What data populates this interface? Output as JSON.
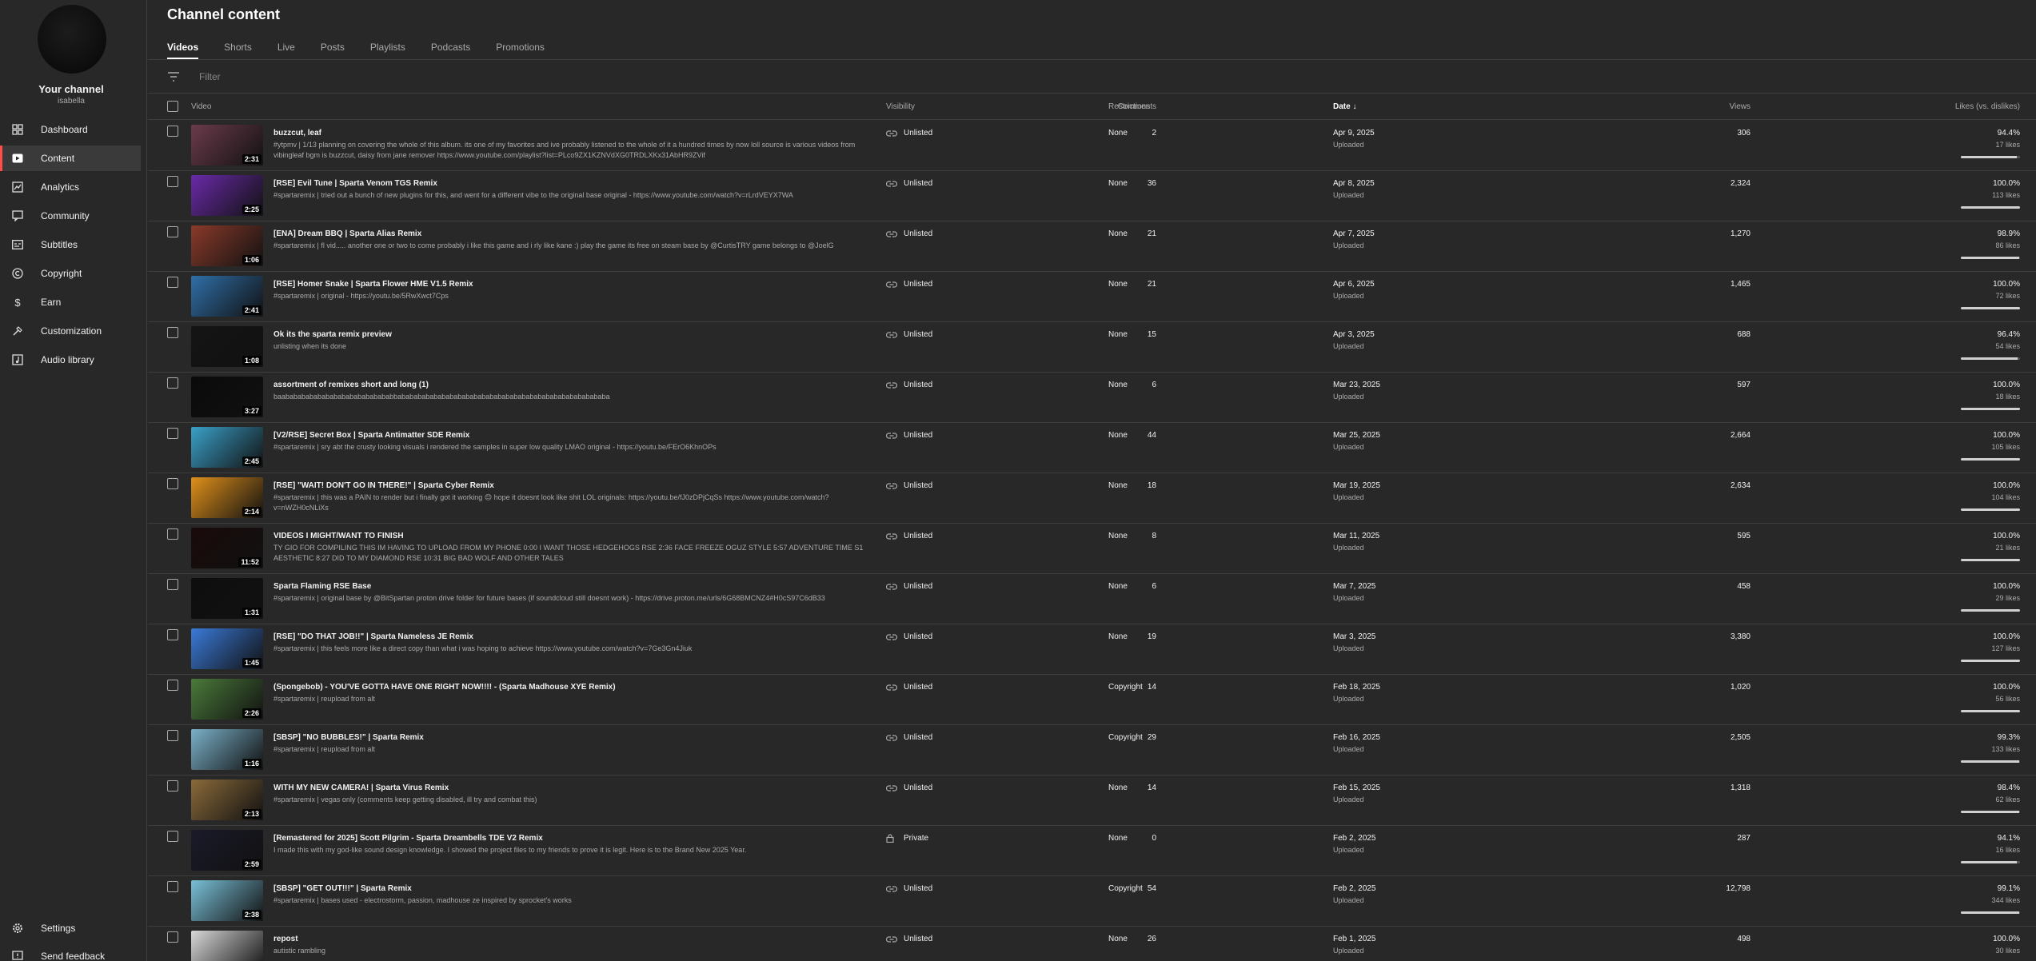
{
  "sidebar": {
    "channel_name": "Your channel",
    "channel_handle": "isabella",
    "items": [
      {
        "label": "Dashboard",
        "icon": "dashboard-icon"
      },
      {
        "label": "Content",
        "icon": "content-icon"
      },
      {
        "label": "Analytics",
        "icon": "analytics-icon"
      },
      {
        "label": "Community",
        "icon": "community-icon"
      },
      {
        "label": "Subtitles",
        "icon": "subtitles-icon"
      },
      {
        "label": "Copyright",
        "icon": "copyright-icon"
      },
      {
        "label": "Earn",
        "icon": "earn-icon"
      },
      {
        "label": "Customization",
        "icon": "customization-icon"
      },
      {
        "label": "Audio library",
        "icon": "audio-library-icon"
      }
    ],
    "bottom_items": [
      {
        "label": "Settings",
        "icon": "settings-icon"
      },
      {
        "label": "Send feedback",
        "icon": "feedback-icon"
      }
    ]
  },
  "page": {
    "title": "Channel content",
    "tabs": [
      "Videos",
      "Shorts",
      "Live",
      "Posts",
      "Playlists",
      "Podcasts",
      "Promotions"
    ],
    "active_tab": "Videos",
    "filter_placeholder": "Filter"
  },
  "table": {
    "headers": {
      "video": "Video",
      "visibility": "Visibility",
      "restrictions": "Restrictions",
      "date": "Date",
      "views": "Views",
      "comments": "Comments",
      "likes": "Likes (vs. dislikes)"
    },
    "rows": [
      {
        "title": "buzzcut, leaf",
        "desc": "#ytpmv | 1/13 planning on covering the whole of this album. its one of my favorites and ive probably listened to the whole of it a hundred times by now loll source is various videos from vibingleaf bgm is buzzcut, daisy from jane remover https://www.youtube.com/playlist?list=PLco9ZX1KZNVdXG0TRDLXKx31AbHR9ZVif",
        "duration": "2:31",
        "visibility": "Unlisted",
        "restrictions": "None",
        "date": "Apr 9, 2025",
        "date_status": "Uploaded",
        "views": "306",
        "comments": "2",
        "likes_pct": "94.4%",
        "likes_count": "17 likes",
        "likes_ratio": 0.944,
        "thumb": "#6b3b4a"
      },
      {
        "title": "[RSE] Evil Tune | Sparta Venom TGS Remix",
        "desc": "#spartaremix | tried out a bunch of new plugins for this, and went for a different vibe to the original base original - https://www.youtube.com/watch?v=rLrdVEYX7WA",
        "duration": "2:25",
        "visibility": "Unlisted",
        "restrictions": "None",
        "date": "Apr 8, 2025",
        "date_status": "Uploaded",
        "views": "2,324",
        "comments": "36",
        "likes_pct": "100.0%",
        "likes_count": "113 likes",
        "likes_ratio": 1.0,
        "thumb": "#6a2aa8"
      },
      {
        "title": "[ENA] Dream BBQ | Sparta Alias Remix",
        "desc": "#spartaremix | fl vid..... another one or two to come probably i like this game and i rly like kane :) play the game its free on steam base by @CurtisTRY game belongs to @JoelG",
        "duration": "1:06",
        "visibility": "Unlisted",
        "restrictions": "None",
        "date": "Apr 7, 2025",
        "date_status": "Uploaded",
        "views": "1,270",
        "comments": "21",
        "likes_pct": "98.9%",
        "likes_count": "86 likes",
        "likes_ratio": 0.989,
        "thumb": "#8a3a2a"
      },
      {
        "title": "[RSE] Homer Snake | Sparta Flower HME V1.5 Remix",
        "desc": "#spartaremix | original - https://youtu.be/5RwXwct7Cps",
        "duration": "2:41",
        "visibility": "Unlisted",
        "restrictions": "None",
        "date": "Apr 6, 2025",
        "date_status": "Uploaded",
        "views": "1,465",
        "comments": "21",
        "likes_pct": "100.0%",
        "likes_count": "72 likes",
        "likes_ratio": 1.0,
        "thumb": "#2f6fa8"
      },
      {
        "title": "Ok its the sparta remix preview",
        "desc": "unlisting when its done",
        "duration": "1:08",
        "visibility": "Unlisted",
        "restrictions": "None",
        "date": "Apr 3, 2025",
        "date_status": "Uploaded",
        "views": "688",
        "comments": "15",
        "likes_pct": "96.4%",
        "likes_count": "54 likes",
        "likes_ratio": 0.964,
        "thumb": "#141414"
      },
      {
        "title": "assortment of remixes short and long (1)",
        "desc": "baababababababababababababababbababababababababababababababababababababababababababa",
        "duration": "3:27",
        "visibility": "Unlisted",
        "restrictions": "None",
        "date": "Mar 23, 2025",
        "date_status": "Uploaded",
        "views": "597",
        "comments": "6",
        "likes_pct": "100.0%",
        "likes_count": "18 likes",
        "likes_ratio": 1.0,
        "thumb": "#0a0a0a"
      },
      {
        "title": "[V2/RSE] Secret Box | Sparta Antimatter SDE Remix",
        "desc": "#spartaremix | sry abt the crusty looking visuals i rendered the samples in super low quality LMAO original - https://youtu.be/FErO6KhnOPs",
        "duration": "2:45",
        "visibility": "Unlisted",
        "restrictions": "None",
        "date": "Mar 25, 2025",
        "date_status": "Uploaded",
        "views": "2,664",
        "comments": "44",
        "likes_pct": "100.0%",
        "likes_count": "105 likes",
        "likes_ratio": 1.0,
        "thumb": "#3aa0c8"
      },
      {
        "title": "[RSE] \"WAIT! DON'T GO IN THERE!\" | Sparta Cyber Remix",
        "desc": "#spartaremix | this was a PAIN to render but i finally got it working 😊 hope it doesnt look like shit LOL originals: https://youtu.be/fJ0zDPjCqSs https://www.youtube.com/watch?v=nWZH0cNLiXs",
        "duration": "2:14",
        "visibility": "Unlisted",
        "restrictions": "None",
        "date": "Mar 19, 2025",
        "date_status": "Uploaded",
        "views": "2,634",
        "comments": "18",
        "likes_pct": "100.0%",
        "likes_count": "104 likes",
        "likes_ratio": 1.0,
        "thumb": "#e0901a"
      },
      {
        "title": "VIDEOS I MIGHT/WANT TO FINISH",
        "desc": "TY GIO FOR COMPILING THIS IM HAVING TO UPLOAD FROM MY PHONE 0:00 I WANT THOSE HEDGEHOGS RSE 2:36 FACE FREEZE OGUZ STYLE 5:57 ADVENTURE TIME S1 AESTHETIC 8:27 DID TO MY DIAMOND RSE 10:31 BIG BAD WOLF AND OTHER TALES",
        "duration": "11:52",
        "visibility": "Unlisted",
        "restrictions": "None",
        "date": "Mar 11, 2025",
        "date_status": "Uploaded",
        "views": "595",
        "comments": "8",
        "likes_pct": "100.0%",
        "likes_count": "21 likes",
        "likes_ratio": 1.0,
        "thumb": "#1a0a0a"
      },
      {
        "title": "Sparta Flaming RSE Base",
        "desc": "#spartaremix | original base by @BitSpartan proton drive folder for future bases (if soundcloud still doesnt work) - https://drive.proton.me/urls/6G68BMCNZ4#H0cS97C6dB33",
        "duration": "1:31",
        "visibility": "Unlisted",
        "restrictions": "None",
        "date": "Mar 7, 2025",
        "date_status": "Uploaded",
        "views": "458",
        "comments": "6",
        "likes_pct": "100.0%",
        "likes_count": "29 likes",
        "likes_ratio": 1.0,
        "thumb": "#0e0e0e"
      },
      {
        "title": "[RSE] \"DO THAT JOB!!\" | Sparta Nameless JE Remix",
        "desc": "#spartaremix | this feels more like a direct copy than what i was hoping to achieve https://www.youtube.com/watch?v=7Ge3Gn4Jiuk",
        "duration": "1:45",
        "visibility": "Unlisted",
        "restrictions": "None",
        "date": "Mar 3, 2025",
        "date_status": "Uploaded",
        "views": "3,380",
        "comments": "19",
        "likes_pct": "100.0%",
        "likes_count": "127 likes",
        "likes_ratio": 1.0,
        "thumb": "#3a7ad8"
      },
      {
        "title": "(Spongebob) - YOU'VE GOTTA HAVE ONE RIGHT NOW!!!! - (Sparta Madhouse XYE Remix)",
        "desc": "#spartaremix | reupload from alt",
        "duration": "2:26",
        "visibility": "Unlisted",
        "restrictions": "Copyright",
        "date": "Feb 18, 2025",
        "date_status": "Uploaded",
        "views": "1,020",
        "comments": "14",
        "likes_pct": "100.0%",
        "likes_count": "56 likes",
        "likes_ratio": 1.0,
        "thumb": "#4a7a3a"
      },
      {
        "title": "[SBSP] \"NO BUBBLES!\" | Sparta Remix",
        "desc": "#spartaremix | reupload from alt",
        "duration": "1:16",
        "visibility": "Unlisted",
        "restrictions": "Copyright",
        "date": "Feb 16, 2025",
        "date_status": "Uploaded",
        "views": "2,505",
        "comments": "29",
        "likes_pct": "99.3%",
        "likes_count": "133 likes",
        "likes_ratio": 0.993,
        "thumb": "#7ab0c8"
      },
      {
        "title": "WITH MY NEW CAMERA! | Sparta Virus Remix",
        "desc": "#spartaremix | vegas only (comments keep getting disabled, ill try and combat this)",
        "duration": "2:13",
        "visibility": "Unlisted",
        "restrictions": "None",
        "date": "Feb 15, 2025",
        "date_status": "Uploaded",
        "views": "1,318",
        "comments": "14",
        "likes_pct": "98.4%",
        "likes_count": "62 likes",
        "likes_ratio": 0.984,
        "thumb": "#8a6a3a"
      },
      {
        "title": "[Remastered for 2025] Scott Pilgrim - Sparta Dreambells TDE V2 Remix",
        "desc": "I made this with my god-like sound design knowledge. I showed the project files to my friends to prove it is legit. Here is to the Brand New 2025 Year.",
        "duration": "2:59",
        "visibility": "Private",
        "restrictions": "None",
        "date": "Feb 2, 2025",
        "date_status": "Uploaded",
        "views": "287",
        "comments": "0",
        "likes_pct": "94.1%",
        "likes_count": "16 likes",
        "likes_ratio": 0.941,
        "thumb": "#1a1a2a"
      },
      {
        "title": "[SBSP] \"GET OUT!!!\" | Sparta Remix",
        "desc": "#spartaremix | bases used - electrostorm, passion, madhouse ze inspired by sprocket's works",
        "duration": "2:38",
        "visibility": "Unlisted",
        "restrictions": "Copyright",
        "date": "Feb 2, 2025",
        "date_status": "Uploaded",
        "views": "12,798",
        "comments": "54",
        "likes_pct": "99.1%",
        "likes_count": "344 likes",
        "likes_ratio": 0.991,
        "thumb": "#7ac0d8"
      },
      {
        "title": "repost",
        "desc": "autistic rambling",
        "duration": "",
        "visibility": "Unlisted",
        "restrictions": "None",
        "date": "Feb 1, 2025",
        "date_status": "Uploaded",
        "views": "498",
        "comments": "26",
        "likes_pct": "100.0%",
        "likes_count": "30 likes",
        "likes_ratio": 1.0,
        "thumb": "#d8d8d8"
      }
    ]
  }
}
